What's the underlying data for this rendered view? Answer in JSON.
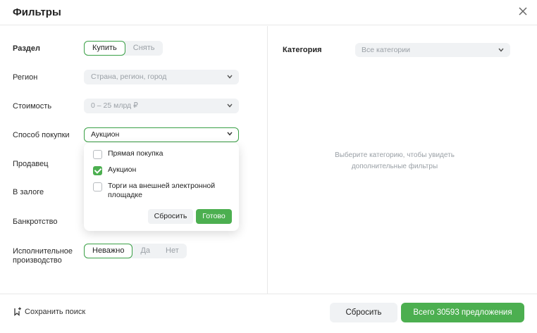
{
  "header": {
    "title": "Фильтры"
  },
  "filters": {
    "section": {
      "label": "Раздел",
      "options": [
        "Купить",
        "Снять"
      ],
      "selected": 0
    },
    "region": {
      "label": "Регион",
      "placeholder": "Страна, регион, город"
    },
    "cost": {
      "label": "Стоимость",
      "value": "0 – 25 млрд ₽"
    },
    "purchase_method": {
      "label": "Способ покупки",
      "value": "Аукцион",
      "options": [
        {
          "label": "Прямая покупка",
          "checked": false
        },
        {
          "label": "Аукцион",
          "checked": true
        },
        {
          "label": "Торги на внешней электронной площадке",
          "checked": false
        }
      ],
      "reset_label": "Сбросить",
      "done_label": "Готово"
    },
    "seller": {
      "label": "Продавец"
    },
    "pledge": {
      "label": "В залоге"
    },
    "bankruptcy": {
      "label": "Банкротство"
    },
    "enforcement": {
      "label": "Исполнительное производство",
      "options": [
        "Неважно",
        "Да",
        "Нет"
      ],
      "selected": 0
    }
  },
  "category": {
    "label": "Категория",
    "value": "Все категории",
    "hint": "Выберите категорию, чтобы увидеть дополнительные фильтры"
  },
  "footer": {
    "save_search": "Сохранить поиск",
    "reset": "Сбросить",
    "show": "Всего 30593 предложения"
  },
  "colors": {
    "accent": "#4caf50",
    "accent_border": "#3aa046",
    "field_bg": "#f0f2f4"
  }
}
